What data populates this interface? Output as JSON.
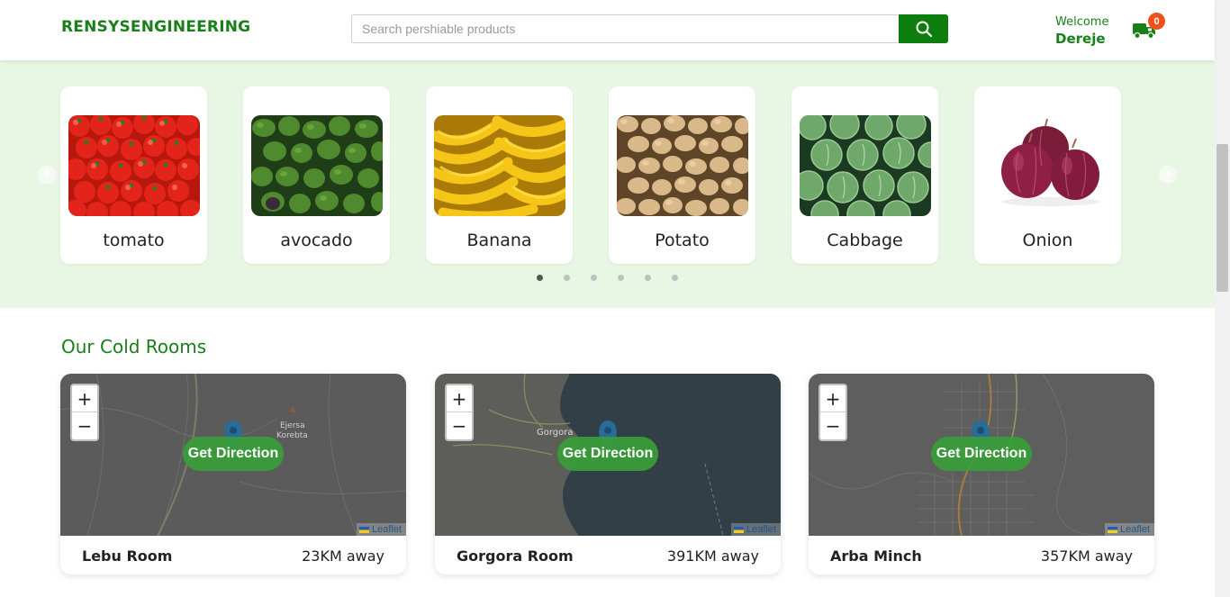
{
  "header": {
    "brand": "RENSYSENGINEERING",
    "search_placeholder": "Search pershiable products",
    "welcome_label": "Welcome",
    "user_name": "Dereje",
    "cart_count": "0",
    "accent_color": "#0d7d0d",
    "badge_color": "#f0511c"
  },
  "products": [
    {
      "name": "tomato",
      "icon": "tomato-image"
    },
    {
      "name": "avocado",
      "icon": "avocado-image"
    },
    {
      "name": "Banana",
      "icon": "banana-image"
    },
    {
      "name": "Potato",
      "icon": "potato-image"
    },
    {
      "name": "Cabbage",
      "icon": "cabbage-image"
    },
    {
      "name": "Onion",
      "icon": "onion-image"
    }
  ],
  "carousel": {
    "dot_count": 6,
    "active_dot": 1
  },
  "cold_rooms": {
    "title": "Our Cold Rooms",
    "direction_label": "Get Direction",
    "zoom_in": "+",
    "zoom_out": "−",
    "attribution": "Leaflet",
    "rooms": [
      {
        "name": "Lebu Room",
        "distance": "23KM away",
        "map_labels": [
          "Ejersa",
          "Korebta"
        ]
      },
      {
        "name": "Gorgora Room",
        "distance": "391KM away",
        "map_labels": [
          "Gorgora"
        ]
      },
      {
        "name": "Arba Minch",
        "distance": "357KM away",
        "map_labels": []
      }
    ]
  }
}
